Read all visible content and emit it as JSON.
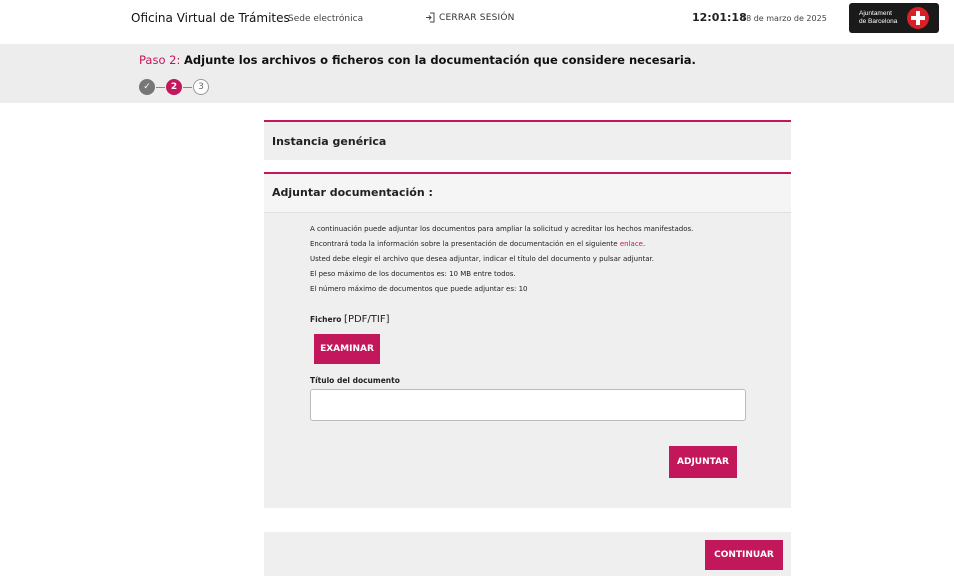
{
  "header": {
    "app_title": "Oficina Virtual de Trámites",
    "sede": "Sede electrónica",
    "logout_label": "CERRAR SESIÓN",
    "time": "12:01:18",
    "date": "28 de marzo de 2025",
    "logo_text_line1": "Ajuntament",
    "logo_text_line2": "de Barcelona"
  },
  "step": {
    "label": "Paso 2:",
    "title": "Adjunte los archivos o ficheros con la documentación que considere necesaria.",
    "steps": [
      {
        "label": "✓",
        "state": "done"
      },
      {
        "label": "2",
        "state": "active"
      },
      {
        "label": "3",
        "state": "pending"
      }
    ]
  },
  "panel_instancia": {
    "title": "Instancia genérica"
  },
  "panel_adjuntar": {
    "title": "Adjuntar documentación :",
    "info_lines": [
      "A continuación puede adjuntar los documentos para ampliar la solicitud y acreditar los hechos manifestados.",
      "Encontrará toda la información sobre la presentación de documentación en el siguiente",
      "Usted debe elegir el archivo que desea adjuntar, indicar el título del documento y pulsar adjuntar.",
      "El peso máximo de los documentos es: 10 MB entre todos.",
      "El número máximo de documentos que puede adjuntar es: 10"
    ],
    "link_text": "enlace",
    "fichero_label": "Fichero",
    "fichero_formats": "[PDF/TIF]",
    "examinar_label": "EXAMINAR",
    "titulo_label": "Título del documento",
    "titulo_value": "",
    "adjuntar_label": "ADJUNTAR"
  },
  "footer": {
    "continuar_label": "CONTINUAR"
  },
  "colors": {
    "accent": "#c2185b",
    "panel_bg": "#efefef",
    "band_bg": "#ededed"
  }
}
